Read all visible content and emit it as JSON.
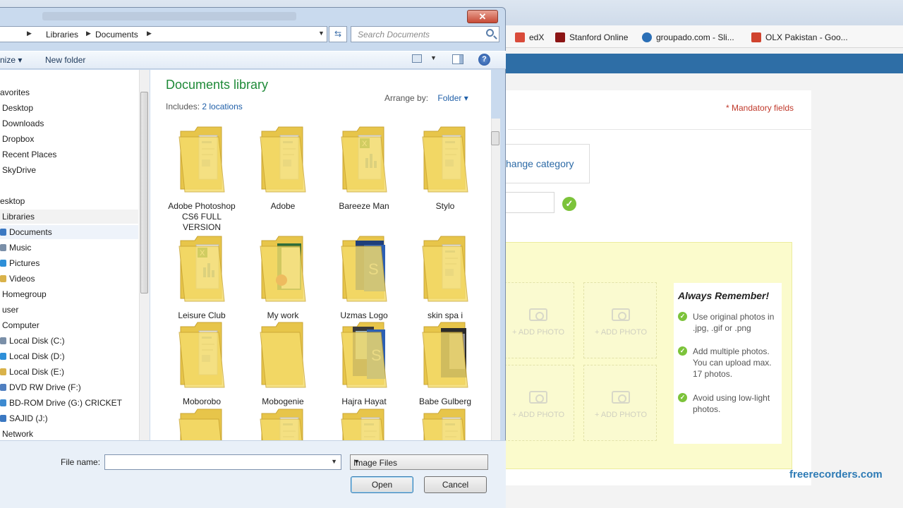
{
  "browser": {
    "bookmarks": [
      {
        "label": "edX",
        "icon": "edx-icon",
        "color": "#d94b3a"
      },
      {
        "label": "Stanford Online",
        "icon": "stanford-icon",
        "color": "#8c1515"
      },
      {
        "label": "groupado.com - Sli...",
        "icon": "groupado-icon",
        "color": "#2b6fb6"
      },
      {
        "label": "OLX Pakistan - Goo...",
        "icon": "olx-icon",
        "color": "#d0432e"
      }
    ],
    "mandatory_label": "* Mandatory fields",
    "change_category": "hange category",
    "add_photo_label": "+ ADD PHOTO",
    "remember": {
      "title": "Always Remember!",
      "tips": [
        "Use original photos in .jpg, .gif or .png",
        "Add multiple photos. You can upload max. 17 photos.",
        "Avoid using low-light photos."
      ]
    },
    "watermark": "freerecorders.com"
  },
  "dialog": {
    "close_symbol": "✕",
    "breadcrumb": [
      "Libraries",
      "Documents"
    ],
    "search_placeholder": "Search Documents",
    "toolbar": {
      "organize": "nize",
      "new_folder": "New folder",
      "help": "?"
    },
    "nav": [
      {
        "label": "avorites",
        "indent": 0,
        "icon": "star-icon"
      },
      {
        "label": "Desktop",
        "indent": 3,
        "icon": "desktop-icon"
      },
      {
        "label": "Downloads",
        "indent": 3,
        "icon": "downloads-icon"
      },
      {
        "label": "Dropbox",
        "indent": 3,
        "icon": "dropbox-icon"
      },
      {
        "label": "Recent Places",
        "indent": 3,
        "icon": "recent-places-icon"
      },
      {
        "label": "SkyDrive",
        "indent": 3,
        "icon": "skydrive-icon"
      },
      {
        "label": "",
        "indent": 0,
        "icon": ""
      },
      {
        "label": "esktop",
        "indent": 0,
        "icon": "desktop-icon"
      },
      {
        "label": "Libraries",
        "indent": 3,
        "icon": "libraries-icon"
      },
      {
        "label": "Documents",
        "indent": 14,
        "icon": "documents-icon"
      },
      {
        "label": "Music",
        "indent": 14,
        "icon": "music-icon"
      },
      {
        "label": "Pictures",
        "indent": 14,
        "icon": "pictures-icon"
      },
      {
        "label": "Videos",
        "indent": 14,
        "icon": "videos-icon"
      },
      {
        "label": "Homegroup",
        "indent": 3,
        "icon": "homegroup-icon"
      },
      {
        "label": "user",
        "indent": 3,
        "icon": "user-icon"
      },
      {
        "label": "Computer",
        "indent": 3,
        "icon": "computer-icon"
      },
      {
        "label": "Local Disk (C:)",
        "indent": 14,
        "icon": "disk-icon"
      },
      {
        "label": "Local Disk (D:)",
        "indent": 14,
        "icon": "disk-icon"
      },
      {
        "label": "Local Disk (E:)",
        "indent": 14,
        "icon": "disk-icon"
      },
      {
        "label": "DVD RW Drive (F:)",
        "indent": 14,
        "icon": "dvd-icon"
      },
      {
        "label": "BD-ROM Drive (G:) CRICKET",
        "indent": 14,
        "icon": "bd-rom-icon"
      },
      {
        "label": "SAJID (J:)",
        "indent": 14,
        "icon": "usb-drive-icon"
      },
      {
        "label": "Network",
        "indent": 3,
        "icon": "network-icon"
      }
    ],
    "library": {
      "title": "Documents library",
      "includes_label": "Includes:",
      "includes_link": "2 locations",
      "arrange_label": "Arrange by:",
      "arrange_value": "Folder"
    },
    "folders": [
      {
        "name": "Adobe Photoshop CS6 FULL VERSION",
        "variant": "docs"
      },
      {
        "name": "Adobe",
        "variant": "docs"
      },
      {
        "name": "Bareeze Man",
        "variant": "excel"
      },
      {
        "name": "Stylo",
        "variant": "docs"
      },
      {
        "name": "Leisure Club",
        "variant": "excel"
      },
      {
        "name": "My work",
        "variant": "photo-red"
      },
      {
        "name": "Uzmas Logo",
        "variant": "photoshop"
      },
      {
        "name": "skin spa i",
        "variant": "docs"
      },
      {
        "name": "Moborobo",
        "variant": "docs"
      },
      {
        "name": "Mobogenie",
        "variant": "empty"
      },
      {
        "name": "Hajra Hayat",
        "variant": "photoshop-dark"
      },
      {
        "name": "Babe Gulberg",
        "variant": "photo-dark"
      },
      {
        "name": "",
        "variant": "empty"
      },
      {
        "name": "",
        "variant": "docs"
      },
      {
        "name": "",
        "variant": "docs"
      },
      {
        "name": "",
        "variant": "docs"
      }
    ],
    "file_name_label": "File name:",
    "file_name_value": "",
    "file_type": "Image Files",
    "open_label": "Open",
    "cancel_label": "Cancel"
  }
}
